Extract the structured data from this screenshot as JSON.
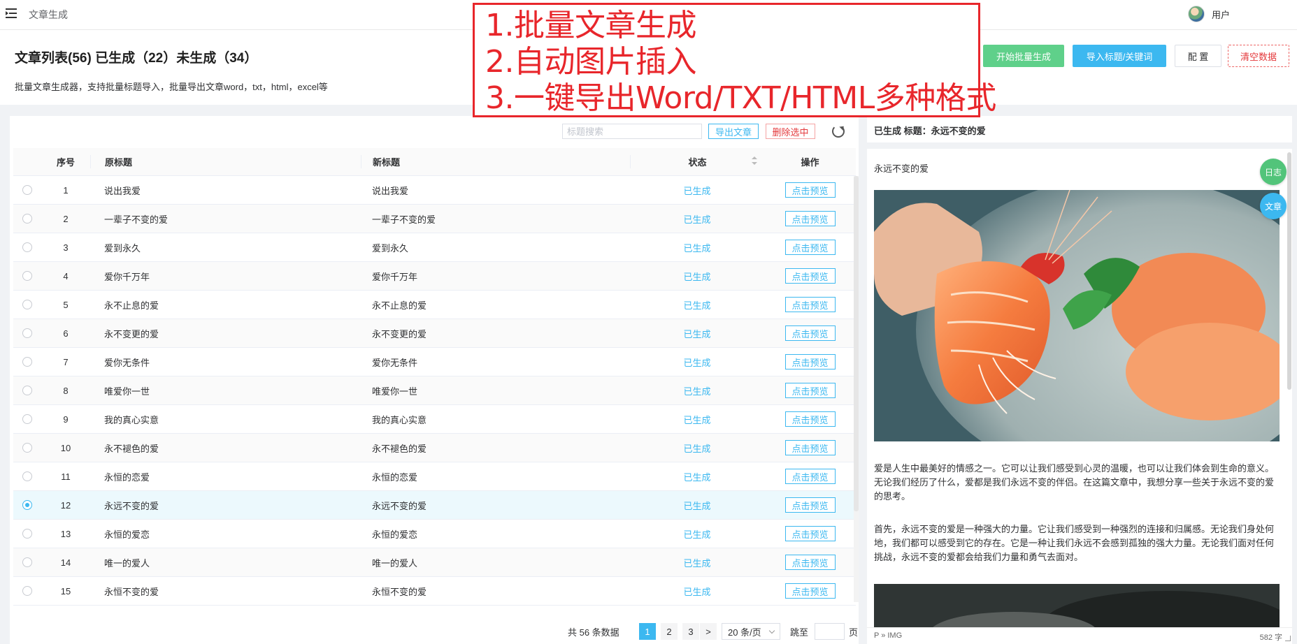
{
  "topbar": {
    "app_title": "文章生成",
    "user_label": "用户"
  },
  "header": {
    "title": "文章列表(56) 已生成（22）未生成（34）",
    "description": "批量文章生成器，支持批量标题导入，批量导出文章word，txt，html，excel等",
    "buttons": {
      "start_batch": "开始批量生成",
      "import_titles": "导入标题/关键词",
      "config": "配 置",
      "clear_data": "清空数据"
    }
  },
  "annotation": {
    "lines": [
      "1.批量文章生成",
      "2.自动图片插入",
      "3.一键导出Word/TXT/HTML多种格式"
    ]
  },
  "toolbar": {
    "search_placeholder": "标题搜索",
    "export_label": "导出文章",
    "delete_label": "删除选中"
  },
  "table": {
    "headers": {
      "index": "序号",
      "original_title": "原标题",
      "new_title": "新标题",
      "status": "状态",
      "action": "操作"
    },
    "rows": [
      {
        "index": "1",
        "original": "说出我爱",
        "new": "说出我爱",
        "status": "已生成",
        "action": "点击预览",
        "selected": false
      },
      {
        "index": "2",
        "original": "一辈子不变的爱",
        "new": "一辈子不变的爱",
        "status": "已生成",
        "action": "点击预览",
        "selected": false
      },
      {
        "index": "3",
        "original": "爱到永久",
        "new": "爱到永久",
        "status": "已生成",
        "action": "点击预览",
        "selected": false
      },
      {
        "index": "4",
        "original": "爱你千万年",
        "new": "爱你千万年",
        "status": "已生成",
        "action": "点击预览",
        "selected": false
      },
      {
        "index": "5",
        "original": "永不止息的爱",
        "new": "永不止息的爱",
        "status": "已生成",
        "action": "点击预览",
        "selected": false
      },
      {
        "index": "6",
        "original": "永不变更的爱",
        "new": "永不变更的爱",
        "status": "已生成",
        "action": "点击预览",
        "selected": false
      },
      {
        "index": "7",
        "original": "爱你无条件",
        "new": "爱你无条件",
        "status": "已生成",
        "action": "点击预览",
        "selected": false
      },
      {
        "index": "8",
        "original": "唯爱你一世",
        "new": "唯爱你一世",
        "status": "已生成",
        "action": "点击预览",
        "selected": false
      },
      {
        "index": "9",
        "original": "我的真心实意",
        "new": "我的真心实意",
        "status": "已生成",
        "action": "点击预览",
        "selected": false
      },
      {
        "index": "10",
        "original": "永不褪色的爱",
        "new": "永不褪色的爱",
        "status": "已生成",
        "action": "点击预览",
        "selected": false
      },
      {
        "index": "11",
        "original": "永恒的恋爱",
        "new": "永恒的恋爱",
        "status": "已生成",
        "action": "点击预览",
        "selected": false
      },
      {
        "index": "12",
        "original": "永远不变的爱",
        "new": "永远不变的爱",
        "status": "已生成",
        "action": "点击预览",
        "selected": true
      },
      {
        "index": "13",
        "original": "永恒的爱恋",
        "new": "永恒的爱恋",
        "status": "已生成",
        "action": "点击预览",
        "selected": false
      },
      {
        "index": "14",
        "original": "唯一的爱人",
        "new": "唯一的爱人",
        "status": "已生成",
        "action": "点击预览",
        "selected": false
      },
      {
        "index": "15",
        "original": "永恒不变的爱",
        "new": "永恒不变的爱",
        "status": "已生成",
        "action": "点击预览",
        "selected": false
      }
    ]
  },
  "pagination": {
    "total": "共 56 条数据",
    "pages": [
      "1",
      "2",
      "3"
    ],
    "current_page": "1",
    "next": ">",
    "page_size": "20 条/页",
    "jump_label": "跳至",
    "page_suffix": "页"
  },
  "preview": {
    "heading": "已生成 标题：永远不变的爱",
    "article_title": "永远不变的爱",
    "paragraph1": "爱是人生中最美好的情感之一。它可以让我们感受到心灵的温暖，也可以让我们体会到生命的意义。无论我们经历了什么，爱都是我们永远不变的伴侣。在这篇文章中，我想分享一些关于永远不变的爱的思考。",
    "paragraph2": "首先，永远不变的爱是一种强大的力量。它让我们感受到一种强烈的连接和归属感。无论我们身处何地，我们都可以感受到它的存在。它是一种让我们永远不会感到孤独的强大力量。无论我们面对任何挑战，永远不变的爱都会给我们力量和勇气去面对。",
    "status_path": "P » IMG",
    "word_count": "582 字",
    "float_log": "日志",
    "float_article": "文章"
  },
  "colors": {
    "accent_blue": "#3cb8f0",
    "start_green": "#5fd08a",
    "danger_red": "#e4393c",
    "annotation_red": "#e8262b"
  }
}
